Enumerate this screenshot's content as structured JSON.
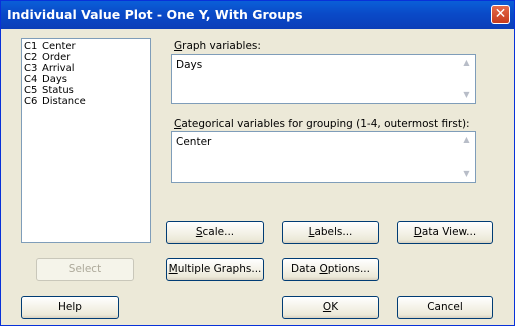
{
  "window": {
    "title": "Individual Value Plot - One Y, With Groups",
    "close_glyph": "✕"
  },
  "variables": [
    {
      "id": "C1",
      "name": "Center"
    },
    {
      "id": "C2",
      "name": "Order"
    },
    {
      "id": "C3",
      "name": "Arrival"
    },
    {
      "id": "C4",
      "name": "Days"
    },
    {
      "id": "C5",
      "name": "Status"
    },
    {
      "id": "C6",
      "name": "Distance"
    }
  ],
  "graph_variables": {
    "label_accel": "G",
    "label_rest": "raph variables:",
    "value": "Days"
  },
  "categorical": {
    "label_accel": "C",
    "label_rest": "ategorical variables for grouping (1-4, outermost first):",
    "value": "Center"
  },
  "buttons": {
    "scale": {
      "accel": "S",
      "rest": "cale..."
    },
    "labels": {
      "accel": "L",
      "rest": "abels..."
    },
    "data_view": {
      "accel": "D",
      "rest": "ata View..."
    },
    "select": {
      "label": "Select"
    },
    "multiple_graphs": {
      "accel": "M",
      "rest": "ultiple Graphs..."
    },
    "data_options": {
      "pre": "Data ",
      "accel": "O",
      "rest": "ptions..."
    },
    "help": {
      "label": "Help"
    },
    "ok": {
      "accel": "O",
      "rest": "K"
    },
    "cancel": {
      "label": "Cancel"
    }
  },
  "icons": {
    "scroll_up": "▲",
    "scroll_down": "▼"
  },
  "colors": {
    "title_bar": "#0a4ac8",
    "dialog_bg": "#ece9d8",
    "close_button": "#d2502f",
    "border": "#7f9db9"
  }
}
